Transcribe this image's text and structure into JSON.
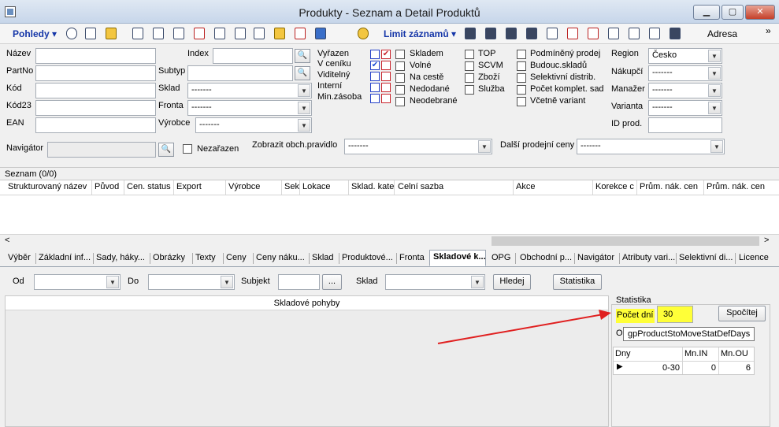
{
  "window": {
    "title": "Produkty - Seznam a Detail Produktů"
  },
  "toolbar": {
    "pohledy": "Pohledy ▾",
    "limit": "Limit záznamů ▾",
    "adresa": "Adresa",
    "more": "»"
  },
  "filters": {
    "nazev": "Název",
    "partno": "PartNo",
    "kod": "Kód",
    "kod23": "Kód23",
    "ean": "EAN",
    "index": "Index",
    "subtyp": "Subtyp",
    "sklad": "Sklad",
    "fronta": "Fronta",
    "vyrobce": "Výrobce",
    "dash": "-------",
    "navigator": "Navigátor",
    "nezarazen": "Nezařazen",
    "obch_pravidlo": "Zobrazit obch.pravidlo",
    "dalsi_ceny": "Další prodejní ceny",
    "region": "Region",
    "region_value": "Česko",
    "nakupci": "Nákupčí",
    "manazer": "Manažer",
    "varianta": "Varianta",
    "id_prod": "ID prod.",
    "checks": {
      "vyrazen": "Vyřazen",
      "v_ceniku": "V ceníku",
      "viditelny": "Viditelný",
      "interni": "Interní",
      "min_zasoba": "Min.zásoba",
      "skladem": "Skladem",
      "volne": "Volné",
      "na_ceste": "Na cestě",
      "nedodane": "Nedodané",
      "neodebrane": "Neodebrané",
      "top": "TOP",
      "scvm": "SCVM",
      "zbozi": "Zboží",
      "sluzba": "Služba",
      "podmineny": "Podmíněný prodej",
      "budouc": "Budouc.skladů",
      "selektivni": "Selektivní distrib.",
      "pocet_komplet": "Počet komplet. sad",
      "vcetne_variant": "Včetně variant"
    }
  },
  "list": {
    "title": "Seznam (0/0)",
    "columns": [
      "Strukturovaný název",
      "Původ",
      "Cen. status",
      "Export",
      "Výrobce",
      "Sek",
      "Lokace",
      "Sklad. kate",
      "Celní sazba",
      "Akce",
      "Korekce c",
      "Prům. nák. cen",
      "Prům. nák. cen"
    ]
  },
  "tabs": [
    "Výběr",
    "Základní inf...",
    "Sady, háky...",
    "Obrázky",
    "Texty",
    "Ceny",
    "Ceny náku...",
    "Sklad",
    "Produktové...",
    "Fronta",
    "Skladové k...",
    "OPG",
    "Obchodní p...",
    "Navigátor",
    "Atributy vari...",
    "Selektivní di...",
    "Licence"
  ],
  "detail": {
    "od": "Od",
    "do": "Do",
    "subjekt": "Subjekt",
    "sklad": "Sklad",
    "ellipsis": "...",
    "hledej": "Hledej",
    "statistika_btn": "Statistika",
    "skladove_pohyby": "Skladové pohyby",
    "statistika_group": "Statistika",
    "pocet_dni": "Počet dní",
    "pocet_dni_value": "30",
    "spocitej": "Spočítej",
    "o_label": "O",
    "tooltip": "gpProductStoMoveStatDefDays",
    "stat_cols": [
      "Dny",
      "Mn.IN",
      "Mn.OU"
    ],
    "stat_row": {
      "dny": "0-30",
      "in": "0",
      "out": "6"
    }
  },
  "colors": {
    "highlight": "#ffff38",
    "arrow": "#e02020",
    "toolbar_text": "#1536a8"
  }
}
